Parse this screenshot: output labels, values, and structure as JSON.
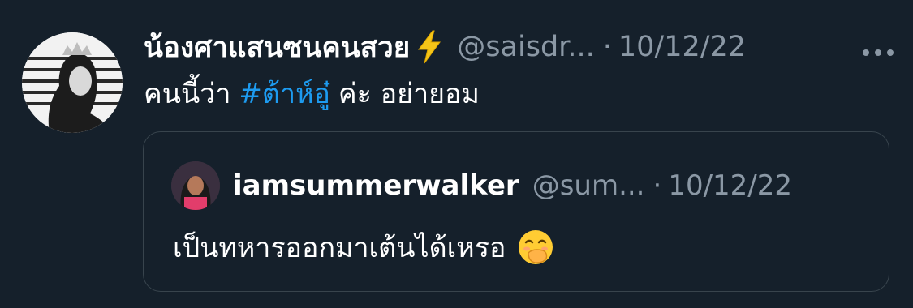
{
  "tweet": {
    "display_name": "น้องศาแสนซนคนสวย",
    "handle": "@saisdr...",
    "separator": "·",
    "date": "10/12/22",
    "text_before": "คนนี้ว่า",
    "hashtag": "#ต้าห์อู๋",
    "text_after": "ค่ะ อย่ายอม",
    "name_emoji": "lightning-bolt-icon",
    "menu_icon": "more-options-icon"
  },
  "quoted_tweet": {
    "display_name": "iamsummerwalker",
    "handle": "@sum...",
    "separator": "·",
    "date": "10/12/22",
    "text": "เป็นทหารออกมาเต้นได้เหรอ",
    "emoji": "face-with-hand-over-mouth-icon"
  },
  "colors": {
    "background": "#15202b",
    "secondary_text": "#8b98a5",
    "link": "#1d9bf0",
    "border": "#38444d"
  }
}
